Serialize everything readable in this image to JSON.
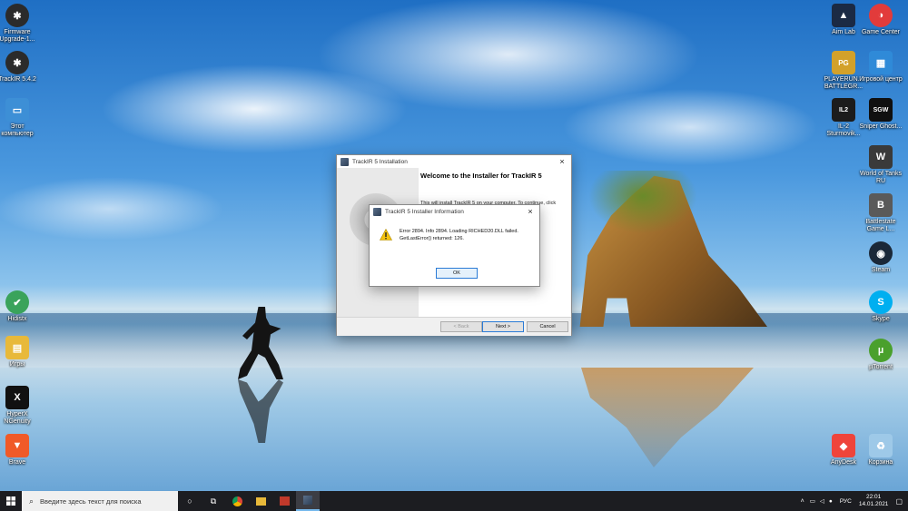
{
  "desktop": {
    "left_icons": [
      {
        "label": "Firmware Upgrade-1...",
        "icon": "trackir-icon",
        "color": "#2b2b2b",
        "glyph": "✱"
      },
      {
        "label": "TrackIR 5.4.2",
        "icon": "trackir-icon",
        "color": "#2b2b2b",
        "glyph": "✱"
      },
      {
        "label": "Этот компьютер",
        "icon": "computer-icon",
        "color": "#3d8fd6",
        "glyph": "▭"
      },
      {
        "label": "Hidistx",
        "icon": "app-icon",
        "color": "#3aa35b",
        "glyph": "✔"
      },
      {
        "label": "Игры",
        "icon": "folder-icon",
        "color": "#e8b93a",
        "glyph": "▤"
      },
      {
        "label": "HyperX NGenuity",
        "icon": "hyperx-icon",
        "color": "#111111",
        "glyph": "X"
      },
      {
        "label": "Brave",
        "icon": "brave-icon",
        "color": "#f05a28",
        "glyph": "▼"
      }
    ],
    "right_icons": [
      {
        "label": "Aim Lab",
        "icon": "aimlab-icon",
        "color": "#1b2a44",
        "glyph": "▲"
      },
      {
        "label": "Game Center",
        "icon": "game-center-icon",
        "color": "#e23b3b",
        "glyph": "◑"
      },
      {
        "label": "PLAYERUN... BATTLEGR...",
        "icon": "pubg-icon",
        "color": "#d3a12a",
        "glyph": "PG"
      },
      {
        "label": "Игровой центр",
        "icon": "rubik-cube-icon",
        "color": "#2f8ad8",
        "glyph": "▦"
      },
      {
        "label": "IL-2 Sturmovik...",
        "icon": "il2-icon",
        "color": "#1c1c1c",
        "glyph": "IL2"
      },
      {
        "label": "Sniper Ghost...",
        "icon": "sniper-icon",
        "color": "#101010",
        "glyph": "SGW"
      },
      {
        "label": "World of Tanks RU",
        "icon": "wot-icon",
        "color": "#3a3a3a",
        "glyph": "W"
      },
      {
        "label": "Battlestate Game L...",
        "icon": "battlestate-icon",
        "color": "#5a5a5a",
        "glyph": "B"
      },
      {
        "label": "Steam",
        "icon": "steam-icon",
        "color": "#1b2838",
        "glyph": "◉"
      },
      {
        "label": "Skype",
        "icon": "skype-icon",
        "color": "#00aff0",
        "glyph": "S"
      },
      {
        "label": "µTorrent",
        "icon": "utorrent-icon",
        "color": "#4aa02c",
        "glyph": "µ"
      },
      {
        "label": "AnyDesk",
        "icon": "anydesk-icon",
        "color": "#ef443b",
        "glyph": "◆"
      },
      {
        "label": "Корзина",
        "icon": "recycle-bin-icon",
        "color": "#9ec9e8",
        "glyph": "♻"
      }
    ]
  },
  "installer": {
    "title": "TrackIR 5 Installation",
    "heading": "Welcome to the Installer for TrackIR 5",
    "body": "This will install TrackIR 5 on your computer. To continue, click",
    "back_label": "< Back",
    "next_label": "Next >",
    "cancel_label": "Cancel"
  },
  "error_dialog": {
    "title": "TrackIR 5 Installer Information",
    "message_line1": "Error 2894. Info 2894. Loading RICHED20.DLL failed.",
    "message_line2": "GetLastError() returned: 126.",
    "ok_label": "OK",
    "warning_color": "#f4c20d"
  },
  "taskbar": {
    "search_placeholder": "Введите здесь текст для поиска",
    "language": "РУС",
    "time": "22:01",
    "date": "14.01.2021"
  }
}
